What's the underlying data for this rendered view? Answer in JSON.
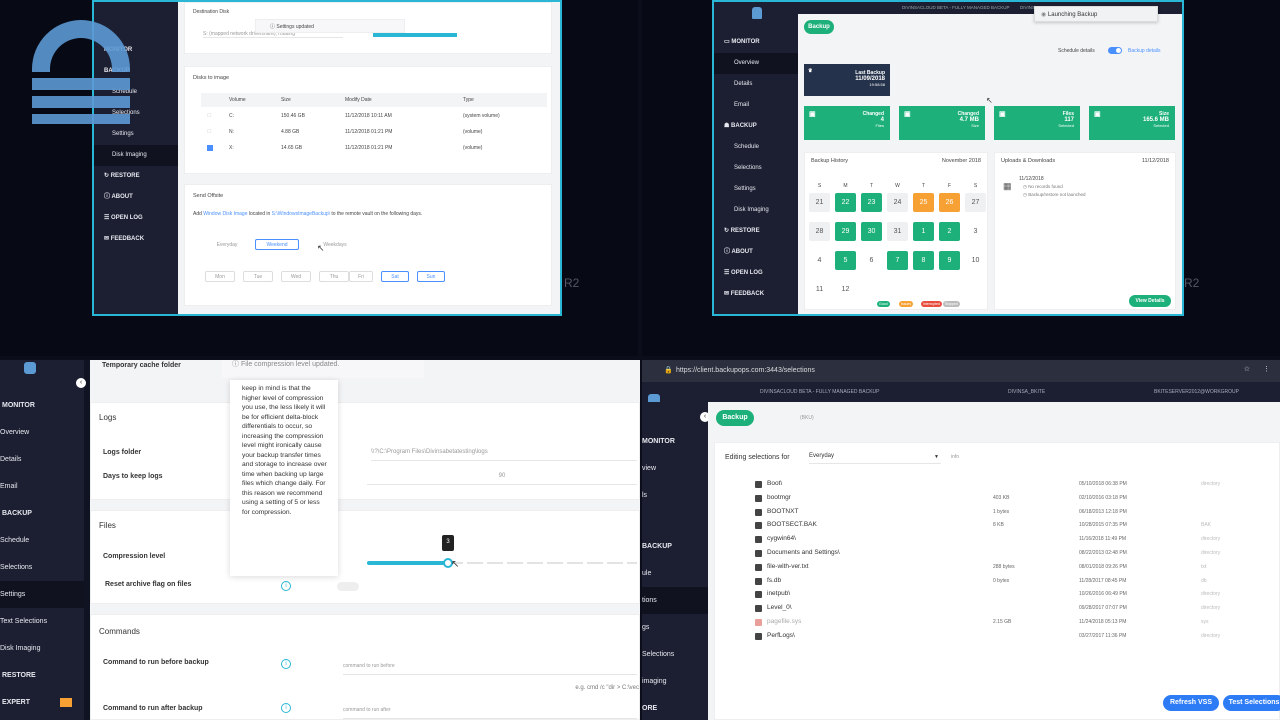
{
  "q1": {
    "sidebar": [
      {
        "label": "MONITOR",
        "icon": "monitor-icon"
      },
      {
        "label": "BACKUP",
        "icon": "backup-icon"
      },
      {
        "label": "Schedule"
      },
      {
        "label": "Selections"
      },
      {
        "label": "Settings"
      },
      {
        "label": "Disk Imaging"
      },
      {
        "label": "RESTORE",
        "icon": "restore-icon"
      },
      {
        "label": "ABOUT",
        "icon": "about-icon"
      },
      {
        "label": "OPEN LOG",
        "icon": "open-log-icon"
      },
      {
        "label": "FEEDBACK",
        "icon": "feedback-icon"
      }
    ],
    "toast": "Settings updated",
    "dest_label": "Destination Disk",
    "dest_value": "S: (mapped network drive/share), rotating",
    "disks_title": "Disks to image",
    "cols": [
      "Volume",
      "Size",
      "Modify Date",
      "Type"
    ],
    "disks": [
      {
        "vol": "C:",
        "size": "150.46 GB",
        "date": "11/12/2018 10:11 AM",
        "type": "(system volume)",
        "checked": false
      },
      {
        "vol": "N:",
        "size": "4.88 GB",
        "date": "11/12/2018 01:21 PM",
        "type": "(volume)",
        "checked": false
      },
      {
        "vol": "X:",
        "size": "14.65 GB",
        "date": "11/12/2018 01:21 PM",
        "type": "(volume)",
        "checked": true
      }
    ],
    "offsite_title": "Send Offsite",
    "offsite_pre": "Add",
    "offsite_link1": "Window Disk Image",
    "offsite_mid": "located in",
    "offsite_link2": "S:\\WindowsImageBackup\\",
    "offsite_post": "to the remote vault on the following days.",
    "day_groups": [
      "Everyday",
      "Weekend",
      "Weekdays"
    ],
    "days": [
      "Mon",
      "Tue",
      "Wed",
      "Thu",
      "Fri",
      "Sat",
      "Sun"
    ],
    "edge_text": "R2"
  },
  "q2": {
    "sidebar": [
      {
        "label": "MONITOR",
        "icon": "monitor-icon"
      },
      {
        "label": "Overview"
      },
      {
        "label": "Details"
      },
      {
        "label": "Email"
      },
      {
        "label": "BACKUP",
        "icon": "backup-icon"
      },
      {
        "label": "Schedule"
      },
      {
        "label": "Selections"
      },
      {
        "label": "Settings"
      },
      {
        "label": "Disk Imaging"
      },
      {
        "label": "RESTORE",
        "icon": "restore-icon"
      },
      {
        "label": "ABOUT",
        "icon": "about-icon"
      },
      {
        "label": "OPEN LOG",
        "icon": "open-log-icon"
      },
      {
        "label": "FEEDBACK",
        "icon": "feedback-icon"
      }
    ],
    "title": "DIVINSACLOUD BETA - FULLY MANAGED BACKUP",
    "user": "DIVINSA_BKITE",
    "toast": "Launching Backup",
    "backup_btn": "Backup",
    "schedule_details": "Schedule details",
    "backup_details": "Backup details",
    "last_backup_label": "Last Backup",
    "last_backup_date": "11/09/2018",
    "last_backup_time": "19:58:58",
    "stats": [
      {
        "label": "Changed",
        "value": "4",
        "sub": "Files",
        "icon": "changed-files-icon"
      },
      {
        "label": "Changed",
        "value": "4.7 MB",
        "sub": "Size",
        "icon": "changed-size-icon"
      },
      {
        "label": "Files",
        "value": "117",
        "sub": "Selected",
        "icon": "files-icon"
      },
      {
        "label": "Size",
        "value": "165.6 MB",
        "sub": "Selected",
        "icon": "size-icon"
      }
    ],
    "history_title": "Backup History",
    "month": "November 2018",
    "weekdays": [
      "S",
      "M",
      "T",
      "W",
      "T",
      "F",
      "S"
    ],
    "cal": [
      {
        "d": "21",
        "s": "plain"
      },
      {
        "d": "22",
        "s": "green"
      },
      {
        "d": "23",
        "s": "green"
      },
      {
        "d": "24",
        "s": "plain"
      },
      {
        "d": "25",
        "s": "orange"
      },
      {
        "d": "26",
        "s": "orange"
      },
      {
        "d": "27",
        "s": "plain"
      },
      {
        "d": "28",
        "s": "plain"
      },
      {
        "d": "29",
        "s": "green"
      },
      {
        "d": "30",
        "s": "green"
      },
      {
        "d": "31",
        "s": "plain"
      },
      {
        "d": "1",
        "s": "green"
      },
      {
        "d": "2",
        "s": "green"
      },
      {
        "d": "3",
        "s": "none"
      },
      {
        "d": "4",
        "s": "none"
      },
      {
        "d": "5",
        "s": "green"
      },
      {
        "d": "6",
        "s": "none"
      },
      {
        "d": "7",
        "s": "green"
      },
      {
        "d": "8",
        "s": "green"
      },
      {
        "d": "9",
        "s": "green"
      },
      {
        "d": "10",
        "s": "none"
      },
      {
        "d": "11",
        "s": "none"
      },
      {
        "d": "12",
        "s": "none"
      }
    ],
    "uploads_title": "Uploads & Downloads",
    "uploads_date": "11/12/2018",
    "uploads_day": "11/12/2018",
    "uploads_l1": "No records found",
    "uploads_l2": "Backup/restore not launched",
    "legend": [
      {
        "label": "Good",
        "color": "#1db07a"
      },
      {
        "label": "Issues",
        "color": "#f7a135"
      },
      {
        "label": "Interrupted",
        "color": "#e74c3c"
      },
      {
        "label": "Skipped",
        "color": "#bbbbbb"
      }
    ],
    "view_details": "View Details",
    "edge_text": "R2"
  },
  "q3": {
    "sidebar": [
      {
        "label": "MONITOR"
      },
      {
        "label": "Overview"
      },
      {
        "label": "Details"
      },
      {
        "label": "Email"
      },
      {
        "label": "BACKUP"
      },
      {
        "label": "Schedule"
      },
      {
        "label": "Selections"
      },
      {
        "label": "Settings"
      },
      {
        "label": "Text Selections"
      },
      {
        "label": "Disk Imaging"
      },
      {
        "label": "RESTORE"
      },
      {
        "label": "EXPERT"
      }
    ],
    "temp_label": "Temporary cache folder",
    "toast": "File compression level updated.",
    "tooltip": "keep in mind is that the higher level of compression you use, the less likely it will be for efficient delta-block differentials to occur, so increasing the compression level might ironically cause your backup transfer times and storage to increase over time when backing up large files which change daily. For this reason we recommend using a setting of 5 or less for compression.",
    "logs_title": "Logs",
    "logs_folder_label": "Logs folder",
    "logs_folder_value": "\\\\?\\C:\\Program Files\\Divinsabetatesting\\logs",
    "days_keep_label": "Days to keep logs",
    "days_keep_value": "90",
    "files_title": "Files",
    "compression_label": "Compression level",
    "compression_value": "3",
    "compression_max": 10,
    "reset_archive_label": "Reset archive flag on files",
    "commands_title": "Commands",
    "cmd_before_label": "Command to run before backup",
    "cmd_before_ph": "command to run before",
    "cmd_after_label": "Command to run after backup",
    "cmd_after_ph": "command to run after",
    "example": "e.g. cmd /c \"dir > C:\\vec"
  },
  "q4": {
    "url": "https://client.backupops.com:3443/selections",
    "title": "DIVINSACLOUD BETA - FULLY MANAGED BACKUP",
    "user": "DIVINSA_BKITE",
    "machine": "BKITESERVER2012@WORKGROUP",
    "sidebar": [
      {
        "label": "MONITOR"
      },
      {
        "label": "view"
      },
      {
        "label": "ls"
      },
      {
        "label": "BACKUP"
      },
      {
        "label": "ule"
      },
      {
        "label": "tions"
      },
      {
        "label": "gs"
      },
      {
        "label": "Selections"
      },
      {
        "label": "imaging"
      },
      {
        "label": "ORE"
      }
    ],
    "backup_btn": "Backup",
    "status": "(BKU)",
    "editing_label": "Editing selections for",
    "editing_value": "Everyday",
    "editing_info": "info",
    "files": [
      {
        "name": "Boot\\",
        "size": "",
        "date": "05/10/2018 06:38 PM",
        "type": "directory",
        "kind": "folder"
      },
      {
        "name": "bootmgr",
        "size": "403 KB",
        "date": "02/10/2016 03:18 PM",
        "type": "",
        "kind": "file"
      },
      {
        "name": "BOOTNXT",
        "size": "1 bytes",
        "date": "06/18/2013 12:18 PM",
        "type": "",
        "kind": "file"
      },
      {
        "name": "BOOTSECT.BAK",
        "size": "8 KB",
        "date": "10/28/2015 07:35 PM",
        "type": "BAK",
        "kind": "file"
      },
      {
        "name": "cygwin64\\",
        "size": "",
        "date": "11/16/2018 11:49 PM",
        "type": "directory",
        "kind": "folder"
      },
      {
        "name": "Documents and Settings\\",
        "size": "",
        "date": "08/22/2013 02:48 PM",
        "type": "directory",
        "kind": "folder"
      },
      {
        "name": "file-with-ver.txt",
        "size": "288 bytes",
        "date": "08/01/2018 09:26 PM",
        "type": "txt",
        "kind": "file"
      },
      {
        "name": "fs.db",
        "size": "0 bytes",
        "date": "11/28/2017 08:45 PM",
        "type": "db",
        "kind": "file"
      },
      {
        "name": "inetpub\\",
        "size": "",
        "date": "10/26/2016 06:49 PM",
        "type": "directory",
        "kind": "folder"
      },
      {
        "name": "Level_0\\",
        "size": "",
        "date": "09/28/2017 07:07 PM",
        "type": "directory",
        "kind": "folder"
      },
      {
        "name": "pagefile.sys",
        "size": "2.15 GB",
        "date": "11/24/2018 05:13 PM",
        "type": "sys",
        "kind": "excluded"
      },
      {
        "name": "PerfLogs\\",
        "size": "",
        "date": "03/27/2017 11:36 PM",
        "type": "directory",
        "kind": "folder"
      }
    ],
    "refresh_vss": "Refresh VSS",
    "test_selections": "Test Selections"
  }
}
